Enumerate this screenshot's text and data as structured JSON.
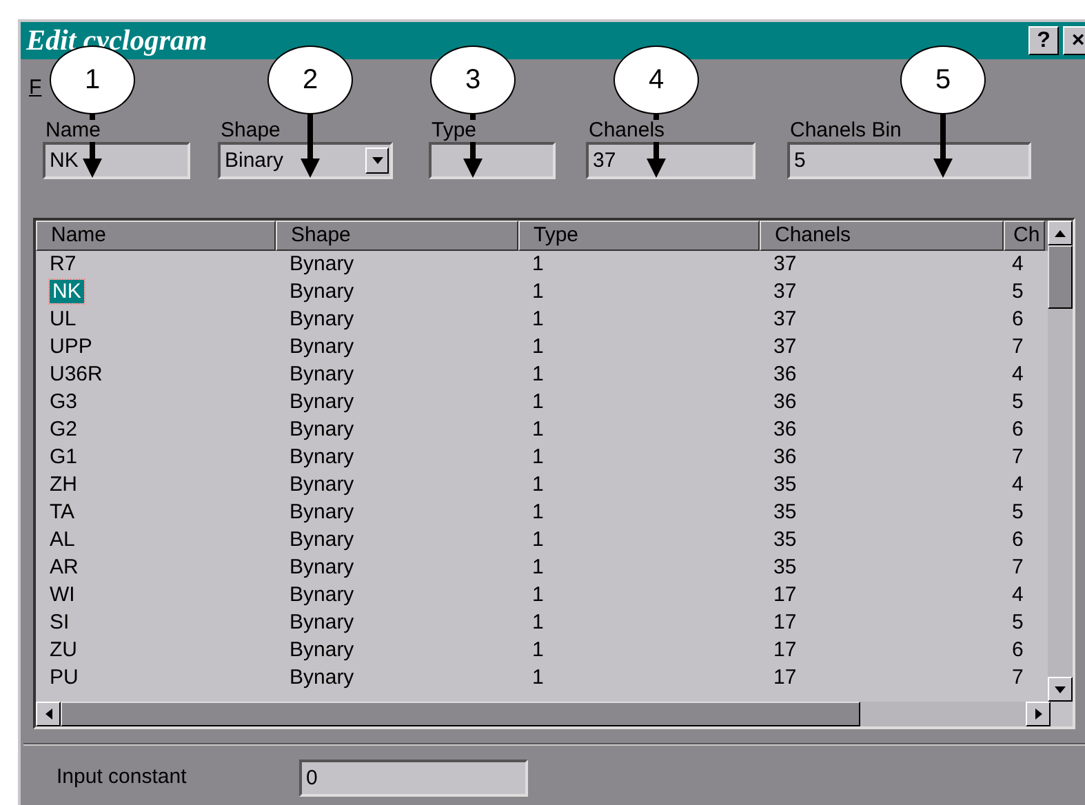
{
  "window": {
    "title": "Edit cyclogram",
    "buttons": [
      "?",
      "×"
    ]
  },
  "menu": [
    "F"
  ],
  "callouts": [
    {
      "number": "1"
    },
    {
      "number": "2"
    },
    {
      "number": "3"
    },
    {
      "number": "4"
    },
    {
      "number": "5"
    }
  ],
  "fields": [
    {
      "label": "Name",
      "value": "NK",
      "kind": "text"
    },
    {
      "label": "Shape",
      "value": "Binary",
      "kind": "combo"
    },
    {
      "label": "Type",
      "kind": "text"
    },
    {
      "label": "Chanels",
      "value": "37",
      "kind": "text"
    },
    {
      "label": "Chanels Bin",
      "value": "5",
      "kind": "text"
    }
  ],
  "table": {
    "columns": [
      "Name",
      "Shape",
      "Type",
      "Chanels",
      "Ch"
    ],
    "rows": [
      {
        "cells": [
          "R7",
          "Bynary",
          "1",
          "37",
          "4"
        ],
        "selected": false
      },
      {
        "cells": [
          "NK",
          "Bynary",
          "1",
          "37",
          "5"
        ],
        "selected": true
      },
      {
        "cells": [
          "UL",
          "Bynary",
          "1",
          "37",
          "6"
        ],
        "selected": false
      },
      {
        "cells": [
          "UPP",
          "Bynary",
          "1",
          "37",
          "7"
        ],
        "selected": false
      },
      {
        "cells": [
          "U36R",
          "Bynary",
          "1",
          "36",
          "4"
        ],
        "selected": false
      },
      {
        "cells": [
          "G3",
          "Bynary",
          "1",
          "36",
          "5"
        ],
        "selected": false
      },
      {
        "cells": [
          "G2",
          "Bynary",
          "1",
          "36",
          "6"
        ],
        "selected": false
      },
      {
        "cells": [
          "G1",
          "Bynary",
          "1",
          "36",
          "7"
        ],
        "selected": false
      },
      {
        "cells": [
          "ZH",
          "Bynary",
          "1",
          "35",
          "4"
        ],
        "selected": false
      },
      {
        "cells": [
          "TA",
          "Bynary",
          "1",
          "35",
          "5"
        ],
        "selected": false
      },
      {
        "cells": [
          "AL",
          "Bynary",
          "1",
          "35",
          "6"
        ],
        "selected": false
      },
      {
        "cells": [
          "AR",
          "Bynary",
          "1",
          "35",
          "7"
        ],
        "selected": false
      },
      {
        "cells": [
          "WI",
          "Bynary",
          "1",
          "17",
          "4"
        ],
        "selected": false
      },
      {
        "cells": [
          "SI",
          "Bynary",
          "1",
          "17",
          "5"
        ],
        "selected": false
      },
      {
        "cells": [
          "ZU",
          "Bynary",
          "1",
          "17",
          "6"
        ],
        "selected": false
      },
      {
        "cells": [
          "PU",
          "Bynary",
          "1",
          "17",
          "7"
        ],
        "selected": false
      }
    ]
  },
  "input_constant": {
    "label": "Input constant",
    "value": "0"
  }
}
